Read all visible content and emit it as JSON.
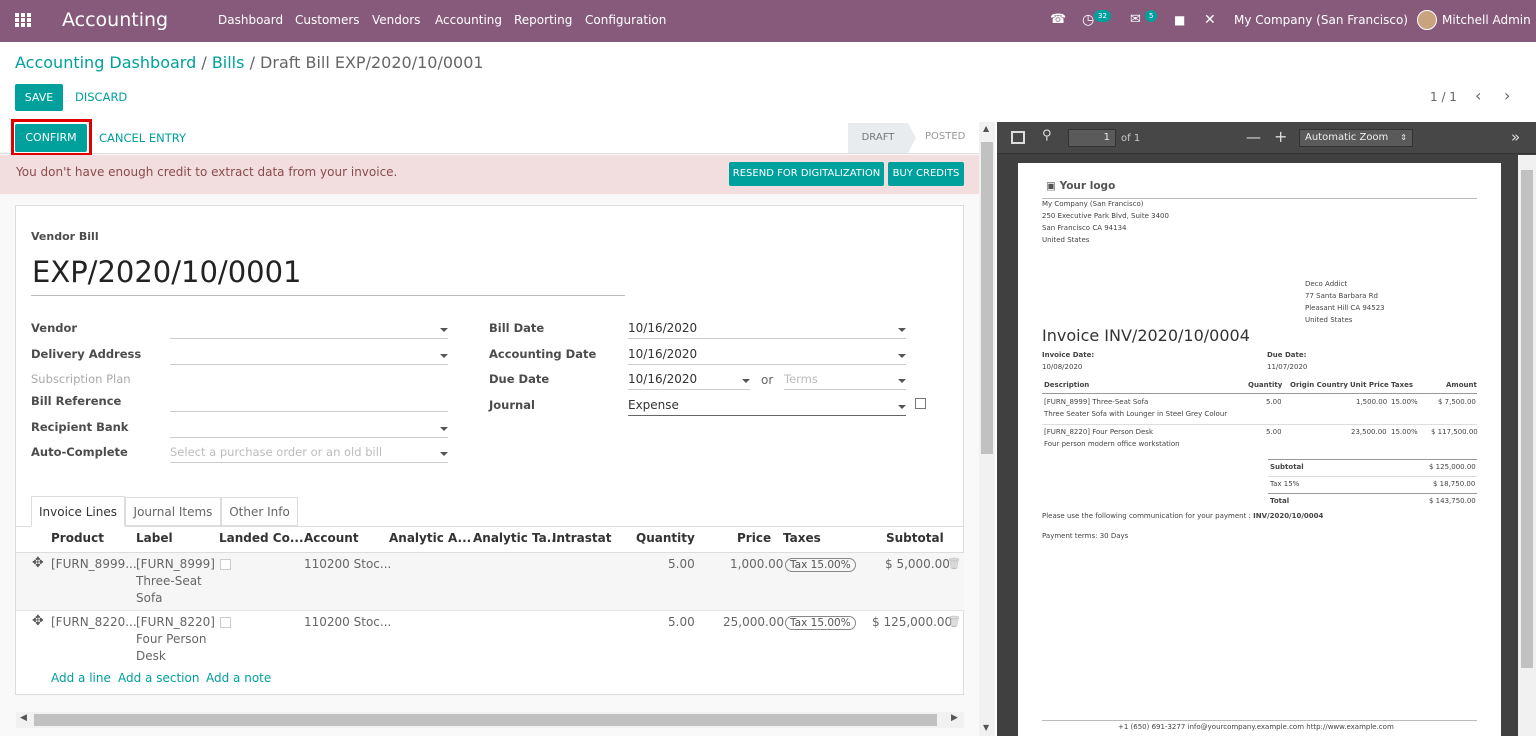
{
  "nav": {
    "app_title": "Accounting",
    "menu": [
      "Dashboard",
      "Customers",
      "Vendors",
      "Accounting",
      "Reporting",
      "Configuration"
    ],
    "activity_count": "32",
    "message_count": "5",
    "company": "My Company (San Francisco)",
    "user": "Mitchell Admin"
  },
  "breadcrumb": {
    "item1": "Accounting Dashboard",
    "sep1": "/",
    "item2": "Bills",
    "sep2": "/",
    "current": "Draft Bill EXP/2020/10/0001"
  },
  "controls": {
    "save": "SAVE",
    "discard": "DISCARD",
    "pager": "1 / 1"
  },
  "statusbar": {
    "confirm": "CONFIRM",
    "cancel_entry": "CANCEL ENTRY",
    "status_draft": "DRAFT",
    "status_posted": "POSTED"
  },
  "alert": {
    "message": "You don't have enough credit to extract data from your invoice.",
    "resend": "RESEND FOR DIGITALIZATION",
    "buy": "BUY CREDITS"
  },
  "form": {
    "type_label": "Vendor Bill",
    "bill_name": "EXP/2020/10/0001",
    "vendor_label": "Vendor",
    "delivery_label": "Delivery Address",
    "subscription_label": "Subscription Plan",
    "billref_label": "Bill Reference",
    "bank_label": "Recipient Bank",
    "autocomplete_label": "Auto-Complete",
    "autocomplete_placeholder": "Select a purchase order or an old bill",
    "billdate_label": "Bill Date",
    "billdate_value": "10/16/2020",
    "accdate_label": "Accounting Date",
    "accdate_value": "10/16/2020",
    "duedate_label": "Due Date",
    "duedate_value": "10/16/2020",
    "or": "or",
    "terms_placeholder": "Terms",
    "journal_label": "Journal",
    "journal_value": "Expense"
  },
  "tabs": [
    "Invoice Lines",
    "Journal Items",
    "Other Info"
  ],
  "table": {
    "headers": [
      "Product",
      "Label",
      "Landed Co...",
      "Account",
      "Analytic A...",
      "Analytic Ta...",
      "Intrastat",
      "Quantity",
      "Price",
      "Taxes",
      "Subtotal"
    ],
    "rows": [
      {
        "product": "[FURN_8999...",
        "label1": "[FURN_8999]",
        "label2": "Three-Seat",
        "label3": "Sofa",
        "account": "110200 Stoc...",
        "qty": "5.00",
        "price": "1,000.00",
        "tax": "Tax 15.00%",
        "subtotal": "$ 5,000.00"
      },
      {
        "product": "[FURN_8220...",
        "label1": "[FURN_8220]",
        "label2": "Four Person",
        "label3": "Desk",
        "account": "110200 Stoc...",
        "qty": "5.00",
        "price": "25,000.00",
        "tax": "Tax 15.00%",
        "subtotal": "$ 125,000.00"
      }
    ],
    "add_line": "Add a line",
    "add_section": "Add a section",
    "add_note": "Add a note"
  },
  "viewer": {
    "page": "1",
    "of": "of 1",
    "zoom": "Automatic Zoom"
  },
  "pdf": {
    "logo": "Your logo",
    "company_lines": [
      "My Company (San Francisco)",
      "250 Executive Park Blvd, Suite 3400",
      "San Francisco CA 94134",
      "United States"
    ],
    "customer_lines": [
      "Deco Addict",
      "77 Santa Barbara Rd",
      "Pleasant Hill CA 94523",
      "United States"
    ],
    "title": "Invoice INV/2020/10/0004",
    "invoice_date_label": "Invoice Date:",
    "invoice_date": "10/08/2020",
    "due_date_label": "Due Date:",
    "due_date": "11/07/2020",
    "headers": [
      "Description",
      "Quantity",
      "Origin Country",
      "Unit Price",
      "Taxes",
      "Amount"
    ],
    "lines": [
      {
        "desc1": "[FURN_8999] Three-Seat Sofa",
        "desc2": "Three Seater Sofa with Lounger in Steel Grey Colour",
        "qty": "5.00",
        "price": "1,500.00",
        "tax": "15.00%",
        "amount": "$ 7,500.00"
      },
      {
        "desc1": "[FURN_8220] Four Person Desk",
        "desc2": "Four person modern office workstation",
        "qty": "5.00",
        "price": "23,500.00",
        "tax": "15.00%",
        "amount": "$ 117,500.00"
      }
    ],
    "subtotal_label": "Subtotal",
    "subtotal": "$ 125,000.00",
    "tax_label": "Tax 15%",
    "tax": "$ 18,750.00",
    "total_label": "Total",
    "total": "$ 143,750.00",
    "communication": "Please use the following communication for your payment :",
    "communication_ref": "INV/2020/10/0004",
    "payment_terms": "Payment terms: 30 Days",
    "footer": "+1 (650) 691-3277  info@yourcompany.example.com  http://www.example.com"
  },
  "colors": {
    "brand": "#875a7b",
    "accent": "#00a09d",
    "alert_bg": "#f2dede",
    "highlight": "#e00000"
  }
}
